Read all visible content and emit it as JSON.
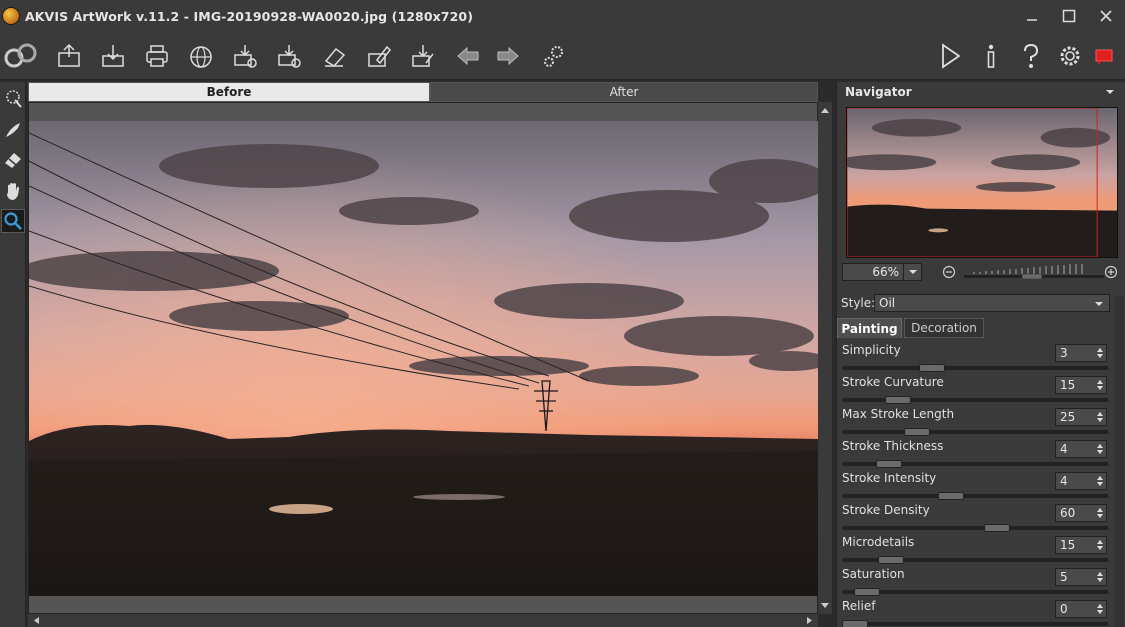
{
  "window": {
    "title": "AKVIS ArtWork v.11.2 - IMG-20190928-WA0020.jpg (1280x720)"
  },
  "toolbar": {
    "icons": [
      "app-logo-icon",
      "open-icon",
      "save-icon",
      "print-icon",
      "share-icon",
      "batch-icon",
      "settings-export-icon",
      "eraser-icon",
      "edit-icon",
      "download-icon",
      "undo-icon",
      "redo-icon",
      "preferences-icon",
      "run-icon",
      "info-icon",
      "help-icon",
      "gear-icon",
      "alert-icon"
    ]
  },
  "view_tabs": {
    "before": "Before",
    "after": "After"
  },
  "navigator": {
    "title": "Navigator",
    "zoom": "66%"
  },
  "settings": {
    "style_label": "Style:",
    "style_value": "Oil",
    "tabs": [
      "Painting",
      "Decoration"
    ],
    "active_tab": "Painting"
  },
  "params": [
    {
      "label": "Simplicity",
      "value": "3",
      "level": 0.32
    },
    {
      "label": "Stroke Curvature",
      "value": "15",
      "level": 0.18
    },
    {
      "label": "Max Stroke Length",
      "value": "25",
      "level": 0.26
    },
    {
      "label": "Stroke Thickness",
      "value": "4",
      "level": 0.14
    },
    {
      "label": "Stroke Intensity",
      "value": "4",
      "level": 0.4
    },
    {
      "label": "Stroke Density",
      "value": "60",
      "level": 0.59
    },
    {
      "label": "Microdetails",
      "value": "15",
      "level": 0.15
    },
    {
      "label": "Saturation",
      "value": "5",
      "level": 0.05
    },
    {
      "label": "Relief",
      "value": "0",
      "level": 0.0
    }
  ],
  "colors": {
    "accent": "#3a9bd5",
    "panel": "#3a3a3a",
    "alert": "#e02020"
  }
}
